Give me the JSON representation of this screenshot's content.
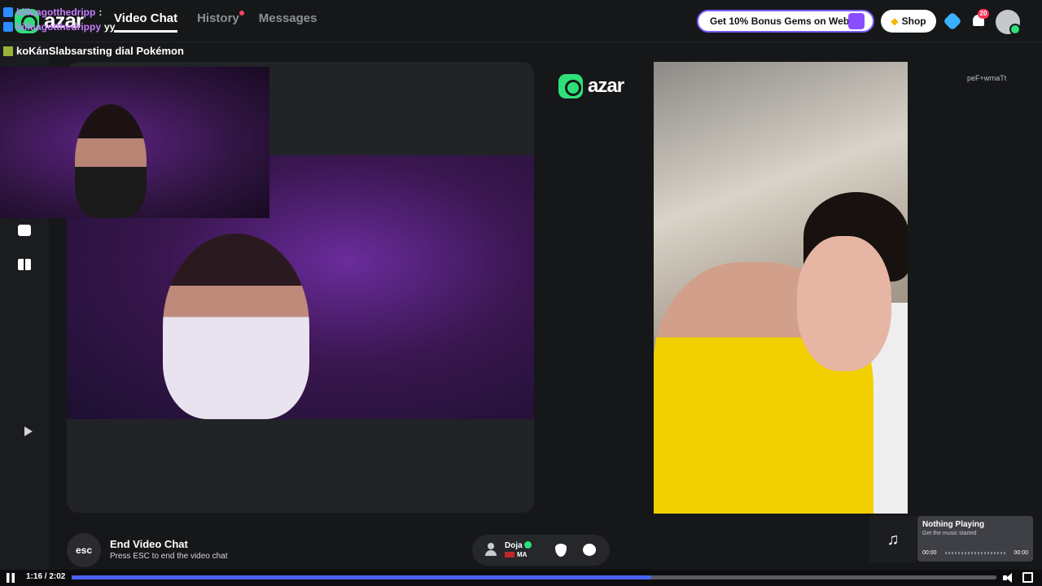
{
  "nav": {
    "brand": "azar",
    "tabs": [
      {
        "label": "Video Chat",
        "active": true
      },
      {
        "label": "History",
        "active": false
      },
      {
        "label": "Messages",
        "active": false
      }
    ],
    "bonus_label": "Get 10% Bonus Gems on Web!",
    "shop_label": "Shop",
    "notification_count": "20"
  },
  "overlay": {
    "chat": [
      {
        "user": "killuagotthedripp",
        "text": ":"
      },
      {
        "user": "killuagotthedrippy",
        "text": "yy"
      }
    ],
    "caption": "koKánSlabsarsting dial Pokémon"
  },
  "video": {
    "watermark": "azar",
    "peer_id": "peF+wrnaTt"
  },
  "controls": {
    "esc_key": "esc",
    "end_title": "End Video Chat",
    "end_subtitle": "Press ESC to end the video chat",
    "peer_name": "Doja",
    "peer_country": "MA"
  },
  "music": {
    "note": "♫",
    "title": "Nothing Playing",
    "subtitle": "Get the music started",
    "start": "00:00",
    "end": "00:00"
  },
  "player": {
    "time": "1:16 / 2:02",
    "progress": 0.627,
    "accent": "#4a63ff"
  },
  "colors": {
    "brand_green": "#2fe07a",
    "badge_red": "#ff3355"
  }
}
